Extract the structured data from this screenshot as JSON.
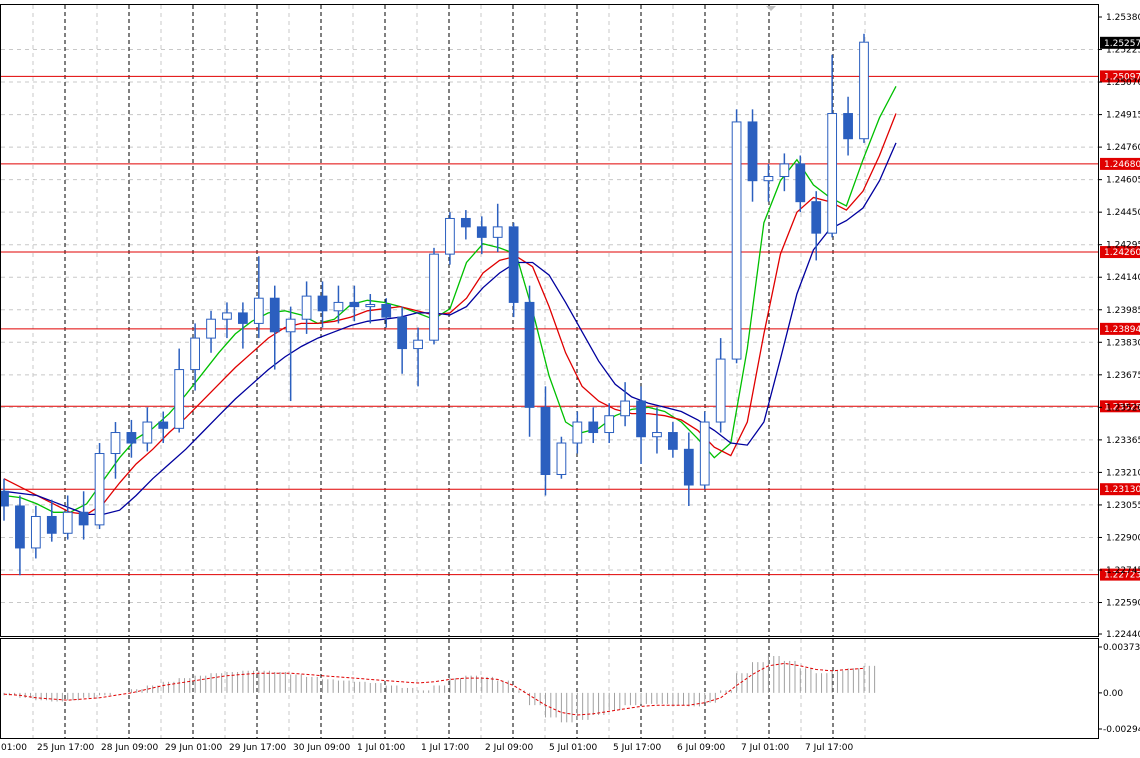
{
  "chart_data": {
    "type": "candlestick",
    "symbol_hint": "",
    "price_axis": {
      "min": 1.2244,
      "max": 1.2538,
      "ticks": [
        "1.25380",
        "1.25225",
        "1.25070",
        "1.24915",
        "1.24760",
        "1.24605",
        "1.24450",
        "1.24295",
        "1.24140",
        "1.23985",
        "1.23830",
        "1.23675",
        "1.23520",
        "1.23365",
        "1.23210",
        "1.23055",
        "1.22900",
        "1.22745",
        "1.22590",
        "1.22440"
      ]
    },
    "time_axis": {
      "labels": [
        "01:00",
        "25 Jun 17:00",
        "28 Jun 09:00",
        "29 Jun 01:00",
        "29 Jun 17:00",
        "30 Jun 09:00",
        "1 Jul 01:00",
        "1 Jul 17:00",
        "2 Jul 09:00",
        "5 Jul 01:00",
        "5 Jul 17:00",
        "6 Jul 09:00",
        "7 Jul 01:00",
        "7 Jul 17:00"
      ]
    },
    "horizontal_levels": [
      {
        "value": "1.25097",
        "color": "#e00000"
      },
      {
        "value": "1.24680",
        "color": "#e00000"
      },
      {
        "value": "1.24260",
        "color": "#e00000"
      },
      {
        "value": "1.23894",
        "color": "#e00000"
      },
      {
        "value": "1.23525",
        "color": "#e00000"
      },
      {
        "value": "1.23130",
        "color": "#e00000"
      },
      {
        "value": "1.22723",
        "color": "#e00000"
      }
    ],
    "current_price": "1.25257",
    "moving_averages": [
      {
        "color": "#00c000",
        "values": [
          1.231,
          1.2309,
          1.2306,
          1.2302,
          1.2302,
          1.2306,
          1.2317,
          1.2328,
          1.2337,
          1.2342,
          1.2349,
          1.2358,
          1.2368,
          1.2378,
          1.2387,
          1.2393,
          1.2397,
          1.2398,
          1.2396,
          1.2392,
          1.2394,
          1.2401,
          1.2403,
          1.2402,
          1.24,
          1.2397,
          1.2394,
          1.2399,
          1.2421,
          1.243,
          1.2428,
          1.2425,
          1.2398,
          1.2367,
          1.2345,
          1.234,
          1.2342,
          1.2348,
          1.2351,
          1.2352,
          1.235,
          1.2345,
          1.2337,
          1.2328,
          1.2335,
          1.238,
          1.244,
          1.246,
          1.247,
          1.2458,
          1.2452,
          1.2448,
          1.247,
          1.249,
          1.2505
        ]
      },
      {
        "color": "#e00000",
        "values": [
          1.2318,
          1.2314,
          1.231,
          1.2306,
          1.2302,
          1.2301,
          1.2306,
          1.2316,
          1.2325,
          1.2332,
          1.234,
          1.2347,
          1.2355,
          1.2363,
          1.2371,
          1.2378,
          1.2385,
          1.239,
          1.2392,
          1.2392,
          1.2393,
          1.2395,
          1.2398,
          1.2399,
          1.24,
          1.2398,
          1.2396,
          1.2397,
          1.2404,
          1.2416,
          1.2422,
          1.2424,
          1.2419,
          1.24,
          1.2378,
          1.2362,
          1.2355,
          1.2351,
          1.2349,
          1.2349,
          1.2348,
          1.2346,
          1.2341,
          1.2333,
          1.2329,
          1.2345,
          1.2387,
          1.2425,
          1.2445,
          1.2452,
          1.245,
          1.2446,
          1.2455,
          1.2472,
          1.2492
        ]
      },
      {
        "color": "#00009e",
        "values": [
          1.2312,
          1.2311,
          1.231,
          1.2307,
          1.2304,
          1.2301,
          1.2301,
          1.2303,
          1.231,
          1.2318,
          1.2325,
          1.2332,
          1.234,
          1.2348,
          1.2356,
          1.2363,
          1.237,
          1.2376,
          1.2381,
          1.2385,
          1.2388,
          1.2391,
          1.2393,
          1.2394,
          1.2395,
          1.2397,
          1.2397,
          1.2396,
          1.24,
          1.2409,
          1.2416,
          1.2421,
          1.2421,
          1.2415,
          1.2402,
          1.2388,
          1.2374,
          1.2363,
          1.2357,
          1.2354,
          1.2352,
          1.235,
          1.2346,
          1.2341,
          1.2335,
          1.2334,
          1.2345,
          1.2375,
          1.2406,
          1.2427,
          1.2437,
          1.2441,
          1.2447,
          1.246,
          1.2478
        ]
      }
    ],
    "candles": [
      {
        "o": 1.2312,
        "h": 1.2318,
        "l": 1.2298,
        "c": 1.2305
      },
      {
        "o": 1.2305,
        "h": 1.231,
        "l": 1.2272,
        "c": 1.2285
      },
      {
        "o": 1.2285,
        "h": 1.2305,
        "l": 1.228,
        "c": 1.23
      },
      {
        "o": 1.23,
        "h": 1.2308,
        "l": 1.2288,
        "c": 1.2292
      },
      {
        "o": 1.2292,
        "h": 1.231,
        "l": 1.2289,
        "c": 1.2302
      },
      {
        "o": 1.2302,
        "h": 1.2312,
        "l": 1.2289,
        "c": 1.2296
      },
      {
        "o": 1.2296,
        "h": 1.2335,
        "l": 1.2294,
        "c": 1.233
      },
      {
        "o": 1.233,
        "h": 1.2345,
        "l": 1.2318,
        "c": 1.234
      },
      {
        "o": 1.234,
        "h": 1.2346,
        "l": 1.2328,
        "c": 1.2335
      },
      {
        "o": 1.2335,
        "h": 1.2352,
        "l": 1.2331,
        "c": 1.2345
      },
      {
        "o": 1.2345,
        "h": 1.235,
        "l": 1.2335,
        "c": 1.2342
      },
      {
        "o": 1.2342,
        "h": 1.238,
        "l": 1.234,
        "c": 1.237
      },
      {
        "o": 1.237,
        "h": 1.2392,
        "l": 1.236,
        "c": 1.2385
      },
      {
        "o": 1.2385,
        "h": 1.2398,
        "l": 1.2378,
        "c": 1.2394
      },
      {
        "o": 1.2394,
        "h": 1.2402,
        "l": 1.2385,
        "c": 1.2397
      },
      {
        "o": 1.2397,
        "h": 1.2402,
        "l": 1.238,
        "c": 1.2392
      },
      {
        "o": 1.2392,
        "h": 1.2424,
        "l": 1.2385,
        "c": 1.2404
      },
      {
        "o": 1.2404,
        "h": 1.241,
        "l": 1.237,
        "c": 1.2388
      },
      {
        "o": 1.2388,
        "h": 1.24,
        "l": 1.2355,
        "c": 1.2394
      },
      {
        "o": 1.2394,
        "h": 1.2412,
        "l": 1.2387,
        "c": 1.2405
      },
      {
        "o": 1.2405,
        "h": 1.2412,
        "l": 1.239,
        "c": 1.2398
      },
      {
        "o": 1.2398,
        "h": 1.241,
        "l": 1.2392,
        "c": 1.2402
      },
      {
        "o": 1.2402,
        "h": 1.241,
        "l": 1.2393,
        "c": 1.24
      },
      {
        "o": 1.24,
        "h": 1.2406,
        "l": 1.2392,
        "c": 1.2401
      },
      {
        "o": 1.2401,
        "h": 1.2404,
        "l": 1.239,
        "c": 1.2395
      },
      {
        "o": 1.2395,
        "h": 1.24,
        "l": 1.2368,
        "c": 1.238
      },
      {
        "o": 1.238,
        "h": 1.239,
        "l": 1.2362,
        "c": 1.2384
      },
      {
        "o": 1.2384,
        "h": 1.2428,
        "l": 1.2382,
        "c": 1.2425
      },
      {
        "o": 1.2425,
        "h": 1.2445,
        "l": 1.242,
        "c": 1.2442
      },
      {
        "o": 1.2442,
        "h": 1.2446,
        "l": 1.2432,
        "c": 1.2438
      },
      {
        "o": 1.2438,
        "h": 1.2443,
        "l": 1.2425,
        "c": 1.2433
      },
      {
        "o": 1.2433,
        "h": 1.2449,
        "l": 1.2426,
        "c": 1.2438
      },
      {
        "o": 1.2438,
        "h": 1.244,
        "l": 1.2395,
        "c": 1.2402
      },
      {
        "o": 1.2402,
        "h": 1.241,
        "l": 1.2338,
        "c": 1.2352
      },
      {
        "o": 1.2352,
        "h": 1.2362,
        "l": 1.231,
        "c": 1.232
      },
      {
        "o": 1.232,
        "h": 1.2338,
        "l": 1.2318,
        "c": 1.2335
      },
      {
        "o": 1.2335,
        "h": 1.235,
        "l": 1.233,
        "c": 1.2345
      },
      {
        "o": 1.2345,
        "h": 1.2352,
        "l": 1.2335,
        "c": 1.234
      },
      {
        "o": 1.234,
        "h": 1.2354,
        "l": 1.2335,
        "c": 1.2348
      },
      {
        "o": 1.2348,
        "h": 1.2364,
        "l": 1.2343,
        "c": 1.2355
      },
      {
        "o": 1.2355,
        "h": 1.2362,
        "l": 1.2325,
        "c": 1.2338
      },
      {
        "o": 1.2338,
        "h": 1.2352,
        "l": 1.233,
        "c": 1.234
      },
      {
        "o": 1.234,
        "h": 1.2345,
        "l": 1.2328,
        "c": 1.2332
      },
      {
        "o": 1.2332,
        "h": 1.234,
        "l": 1.2305,
        "c": 1.2315
      },
      {
        "o": 1.2315,
        "h": 1.235,
        "l": 1.2313,
        "c": 1.2345
      },
      {
        "o": 1.2345,
        "h": 1.2385,
        "l": 1.234,
        "c": 1.2375
      },
      {
        "o": 1.2375,
        "h": 1.2494,
        "l": 1.2373,
        "c": 1.2488
      },
      {
        "o": 1.2488,
        "h": 1.2494,
        "l": 1.245,
        "c": 1.246
      },
      {
        "o": 1.246,
        "h": 1.2468,
        "l": 1.245,
        "c": 1.2462
      },
      {
        "o": 1.2462,
        "h": 1.2473,
        "l": 1.2455,
        "c": 1.2468
      },
      {
        "o": 1.2468,
        "h": 1.2472,
        "l": 1.2445,
        "c": 1.245
      },
      {
        "o": 1.245,
        "h": 1.2455,
        "l": 1.2422,
        "c": 1.2435
      },
      {
        "o": 1.2435,
        "h": 1.252,
        "l": 1.2433,
        "c": 1.2492
      },
      {
        "o": 1.2492,
        "h": 1.25,
        "l": 1.2472,
        "c": 1.248
      },
      {
        "o": 1.248,
        "h": 1.253,
        "l": 1.2478,
        "c": 1.2526
      }
    ],
    "oscillator": {
      "ticks": [
        "0.003733",
        "0.00",
        "-0.00294"
      ],
      "min": -0.00294,
      "max": 0.003733,
      "signal_color": "#e00000",
      "histogram_color": "#a0a0a0",
      "histogram": [
        -0.0002,
        -0.0004,
        -0.0006,
        -0.0007,
        -0.0006,
        -0.0004,
        -0.0002,
        0.0,
        0.0003,
        0.0006,
        0.0009,
        0.0012,
        0.0014,
        0.0016,
        0.0017,
        0.0018,
        0.0018,
        0.0017,
        0.0015,
        0.0013,
        0.0011,
        0.001,
        0.0009,
        0.0008,
        0.0006,
        0.0004,
        0.0002,
        0.0006,
        0.0012,
        0.0014,
        0.0013,
        0.001,
        0.0002,
        -0.001,
        -0.002,
        -0.0024,
        -0.0022,
        -0.0018,
        -0.0014,
        -0.001,
        -0.0009,
        -0.0009,
        -0.001,
        -0.0011,
        -0.0008,
        0.0002,
        0.0016,
        0.0025,
        0.003,
        0.0026,
        0.002,
        0.0016,
        0.0018,
        0.002,
        0.0022
      ],
      "signal": [
        -0.0001,
        -0.0002,
        -0.0004,
        -0.0005,
        -0.0006,
        -0.0005,
        -0.0004,
        -0.0002,
        0.0,
        0.0003,
        0.0006,
        0.0008,
        0.001,
        0.0012,
        0.0014,
        0.0015,
        0.0016,
        0.0016,
        0.0016,
        0.0015,
        0.0014,
        0.0013,
        0.0012,
        0.0011,
        0.001,
        0.0009,
        0.0008,
        0.0009,
        0.0011,
        0.0012,
        0.0012,
        0.0011,
        0.0006,
        -0.0002,
        -0.001,
        -0.0016,
        -0.0018,
        -0.0017,
        -0.0015,
        -0.0013,
        -0.0011,
        -0.001,
        -0.001,
        -0.001,
        -0.0008,
        -0.0004,
        0.0006,
        0.0015,
        0.0022,
        0.0024,
        0.0022,
        0.0019,
        0.0018,
        0.0019,
        0.002
      ]
    }
  }
}
